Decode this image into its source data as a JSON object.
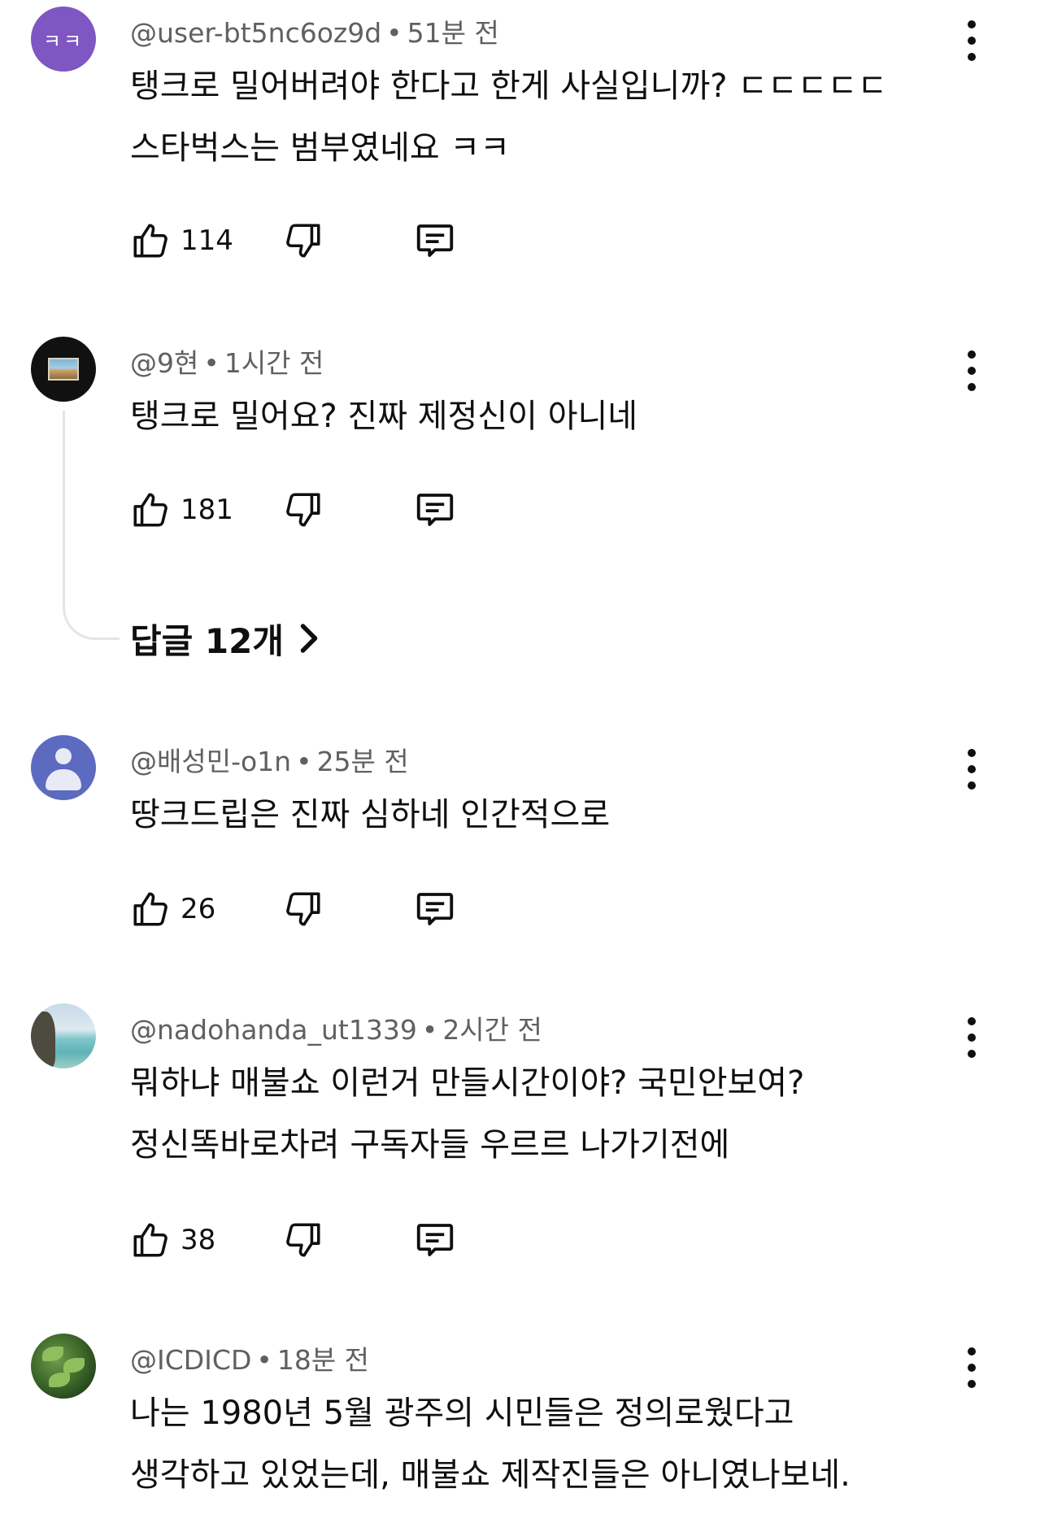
{
  "comments": [
    {
      "avatar_text": "ㅋㅋ",
      "handle": "@user-bt5nc6oz9d",
      "time": "51분 전",
      "lines": [
        "탱크로 밀어버려야 한다고 한게 사실입니까? ㄷㄷㄷㄷㄷ",
        "스타벅스는 범부였네요 ㅋㅋ"
      ],
      "likes": "114"
    },
    {
      "handle": "@9현",
      "time": "1시간 전",
      "lines": [
        "탱크로 밀어요? 진짜 제정신이 아니네"
      ],
      "likes": "181"
    },
    {
      "handle": "@배성민-o1n",
      "time": "25분 전",
      "lines": [
        "땅크드립은 진짜 심하네 인간적으로"
      ],
      "likes": "26"
    },
    {
      "handle": "@nadohanda_ut1339",
      "time": "2시간 전",
      "lines": [
        "뭐하냐 매불쇼 이런거 만들시간이야? 국민안보여?",
        "정신똑바로차려 구독자들 우르르 나가기전에"
      ],
      "likes": "38"
    },
    {
      "handle": "@ICDICD",
      "time": "18분 전",
      "lines": [
        "나는 1980년 5월 광주의 시민들은 정의로웠다고",
        "생각하고 있었는데, 매불쇼 제작진들은 아니였나보네."
      ]
    }
  ],
  "replies_label": "답글 12개",
  "icons": {
    "like": "thumbs-up-icon",
    "dislike": "thumbs-down-icon",
    "reply": "comment-icon",
    "more": "more-vert-icon",
    "chevron": "chevron-right-icon"
  },
  "colors": {
    "avatar_purple": "#7e57c2",
    "avatar_blue": "#5c6bc0",
    "meta_gray": "#606060",
    "text": "#0f0f0f"
  }
}
